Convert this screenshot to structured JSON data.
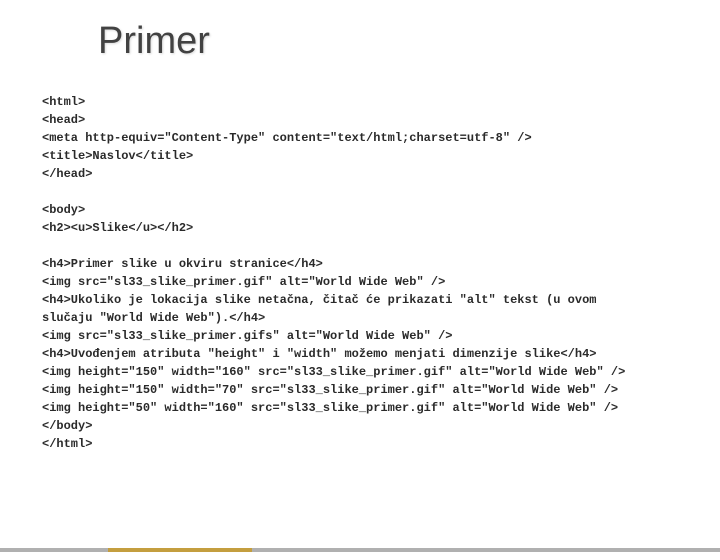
{
  "title": "Primer",
  "code": {
    "l1": "<html>",
    "l2": "<head>",
    "l3": "<meta http-equiv=\"Content-Type\" content=\"text/html;charset=utf-8\" />",
    "l4": "<title>Naslov</title>",
    "l5": "</head>",
    "l6": "",
    "l7": "<body>",
    "l8": "<h2><u>Slike</u></h2>",
    "l9": "",
    "l10": "<h4>Primer slike u okviru stranice</h4>",
    "l11": "<img src=\"sl33_slike_primer.gif\" alt=\"World Wide Web\" />",
    "l12": "<h4>Ukoliko je lokacija slike netačna, čitač će prikazati \"alt\" tekst (u ovom",
    "l13": "slučaju \"World Wide Web\").</h4>",
    "l14": "<img src=\"sl33_slike_primer.gifs\" alt=\"World Wide Web\" />",
    "l15": "<h4>Uvođenjem atributa \"height\" i \"width\" možemo menjati dimenzije slike</h4>",
    "l16": "<img height=\"150\" width=\"160\" src=\"sl33_slike_primer.gif\" alt=\"World Wide Web\" />",
    "l17": "<img height=\"150\" width=\"70\" src=\"sl33_slike_primer.gif\" alt=\"World Wide Web\" />",
    "l18": "<img height=\"50\" width=\"160\" src=\"sl33_slike_primer.gif\" alt=\"World Wide Web\" />",
    "l19": "</body>",
    "l20": "</html>"
  }
}
